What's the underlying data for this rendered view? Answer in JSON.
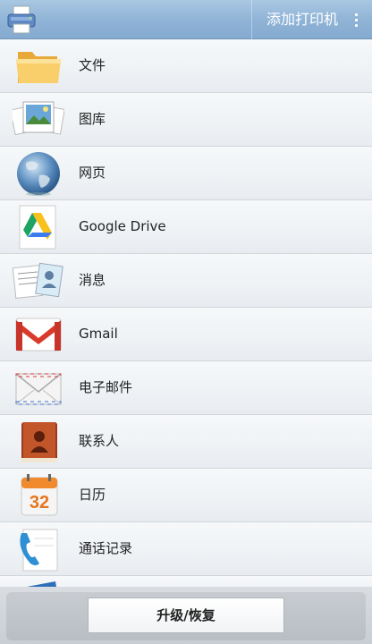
{
  "actionbar": {
    "add_printer_label": "添加打印机",
    "icons": [
      "printer-app-icon",
      "overflow-menu-icon"
    ]
  },
  "menu": {
    "items": [
      {
        "label": "文件",
        "icon": "folder-icon"
      },
      {
        "label": "图库",
        "icon": "gallery-photos-icon"
      },
      {
        "label": "网页",
        "icon": "globe-icon"
      },
      {
        "label": "Google Drive",
        "icon": "google-drive-icon"
      },
      {
        "label": "消息",
        "icon": "messages-icon"
      },
      {
        "label": "Gmail",
        "icon": "gmail-icon"
      },
      {
        "label": "电子邮件",
        "icon": "email-envelope-icon"
      },
      {
        "label": "联系人",
        "icon": "contacts-book-icon"
      },
      {
        "label": "日历",
        "icon": "calendar-icon"
      },
      {
        "label": "通话记录",
        "icon": "phone-call-log-icon"
      }
    ]
  },
  "calendar_icon_day": "32",
  "bottom": {
    "upgrade_restore_label": "升级/恢复"
  },
  "colors": {
    "actionbar": "#8fb3d6",
    "gmail_red": "#d93a2b",
    "drive_green": "#1ea362",
    "drive_yellow": "#f7c21b",
    "drive_blue": "#3b7ded"
  }
}
